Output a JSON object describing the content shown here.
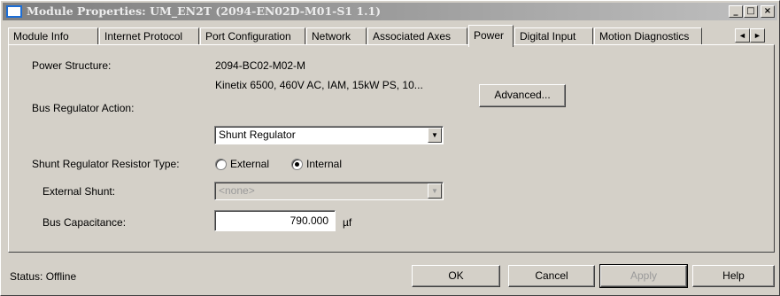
{
  "window": {
    "title": "Module Properties: UM_EN2T (2094-EN02D-M01-S1 1.1)",
    "title_icon": "window-icon",
    "controls": {
      "minimize": "_",
      "maximize": "□",
      "close": "×"
    }
  },
  "tabs": [
    {
      "label": "Module Info"
    },
    {
      "label": "Internet Protocol"
    },
    {
      "label": "Port Configuration"
    },
    {
      "label": "Network"
    },
    {
      "label": "Associated Axes"
    },
    {
      "label": "Power",
      "active": true
    },
    {
      "label": "Digital Input"
    },
    {
      "label": "Motion Diagnostics"
    }
  ],
  "tab_scroll": {
    "left": "◄",
    "right": "►"
  },
  "power": {
    "structure_label": "Power Structure:",
    "structure_value": "2094-BC02-M02-M",
    "structure_desc": "Kinetix 6500, 460V AC, IAM, 15kW PS, 10...",
    "advanced_button": "Advanced...",
    "bus_regulator_label": "Bus Regulator Action:",
    "bus_regulator_value": "Shunt Regulator",
    "shunt_type_label": "Shunt Regulator Resistor Type:",
    "shunt_external": "External",
    "shunt_internal": "Internal",
    "shunt_selected": "Internal",
    "external_shunt_label": "External Shunt:",
    "external_shunt_value": "<none>",
    "bus_capacitance_label": "Bus Capacitance:",
    "bus_capacitance_value": "790.000",
    "bus_capacitance_unit": "µf"
  },
  "footer": {
    "status": "Status:  Offline",
    "ok": "OK",
    "cancel": "Cancel",
    "apply": "Apply",
    "help": "Help"
  },
  "colors": {
    "dialog_bg": "#d4d0c8",
    "titlebar_inactive": "#808080",
    "icon_accent": "#1c6ed6"
  }
}
